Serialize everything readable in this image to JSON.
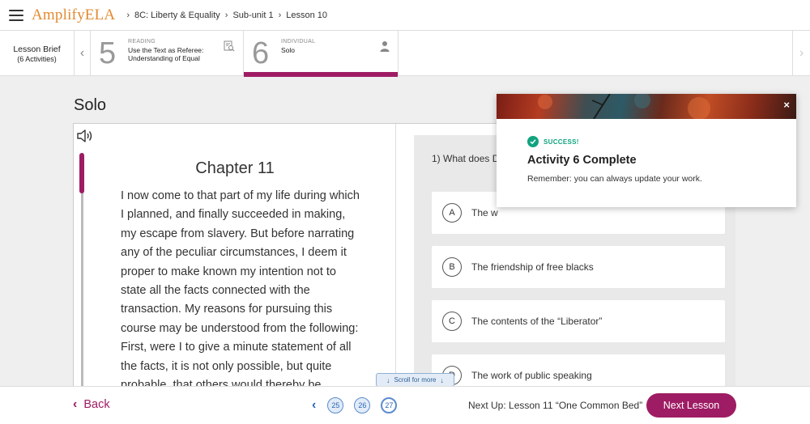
{
  "header": {
    "brand": "AmplifyELA",
    "breadcrumbs": [
      "8C: Liberty & Equality",
      "Sub-unit 1",
      "Lesson 10"
    ]
  },
  "activity_strip": {
    "brief_title": "Lesson Brief",
    "brief_count": "(6 Activities)",
    "activities": [
      {
        "number": "5",
        "kind": "READING",
        "title": "Use the Text as Referee: Understanding of Equal",
        "icon": "document-search-icon"
      },
      {
        "number": "6",
        "kind": "INDIVIDUAL",
        "title": "Solo",
        "icon": "person-icon",
        "active": true
      }
    ]
  },
  "main": {
    "title": "Solo",
    "chapter": "Chapter 11",
    "passage": "I now come to that part of my life during which I planned, and finally succeeded in making, my escape from slavery. But before narrating any of the peculiar circumstances, I deem it proper to make known my intention not to state all the facts connected with the transaction. My reasons for pursuing this course may be understood from the following: First, were I to give a minute statement of all the facts, it is not only possible, but quite probable, that others would thereby be",
    "question": "1) What does D",
    "options": [
      {
        "letter": "A",
        "text": "The w"
      },
      {
        "letter": "B",
        "text": "The friendship of free blacks"
      },
      {
        "letter": "C",
        "text": "The contents of the “Liberator”"
      },
      {
        "letter": "D",
        "text": "The work of public speaking"
      }
    ],
    "scroll_hint": "Scroll for more"
  },
  "toast": {
    "status": "SUCCESS!",
    "heading": "Activity 6 Complete",
    "message": "Remember: you can always update your work.",
    "close": "×"
  },
  "footer": {
    "back_label": "Back",
    "pages": [
      "25",
      "26",
      "27"
    ],
    "current_page": "27",
    "next_up": "Next Up: Lesson 11 “One Common Bed”",
    "next_button": "Next Lesson"
  },
  "colors": {
    "brand_orange": "#e38a2f",
    "accent_magenta": "#9e1c63",
    "success_green": "#10a37f",
    "link_blue": "#2a66b8"
  }
}
